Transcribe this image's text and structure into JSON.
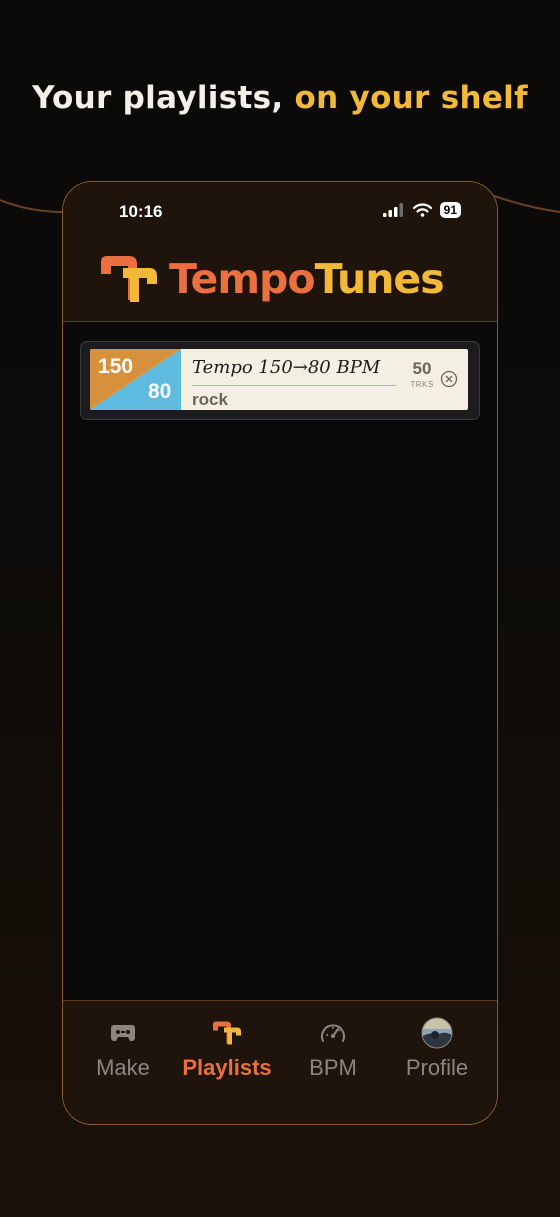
{
  "headline": {
    "main": "Your playlists, ",
    "accent": "on your shelf"
  },
  "status_bar": {
    "time": "10:16",
    "battery": "91"
  },
  "app": {
    "name_part1": "Tempo",
    "name_part2": "Tunes"
  },
  "playlists": [
    {
      "tempo_start": "150",
      "tempo_end": "80",
      "title": "Tempo 150→80 BPM",
      "genre": "rock",
      "track_count": "50",
      "track_label": "TRKS"
    }
  ],
  "tabs": [
    {
      "label": "Make",
      "icon": "cassette-icon",
      "active": false
    },
    {
      "label": "Playlists",
      "icon": "tempotunes-logo-icon",
      "active": true
    },
    {
      "label": "BPM",
      "icon": "speedometer-icon",
      "active": false
    },
    {
      "label": "Profile",
      "icon": "avatar",
      "active": false
    }
  ],
  "colors": {
    "accent_orange": "#ea7040",
    "accent_yellow": "#f2b83a",
    "tempo_start_bg": "#d7903b",
    "tempo_end_bg": "#5fbbdf"
  }
}
